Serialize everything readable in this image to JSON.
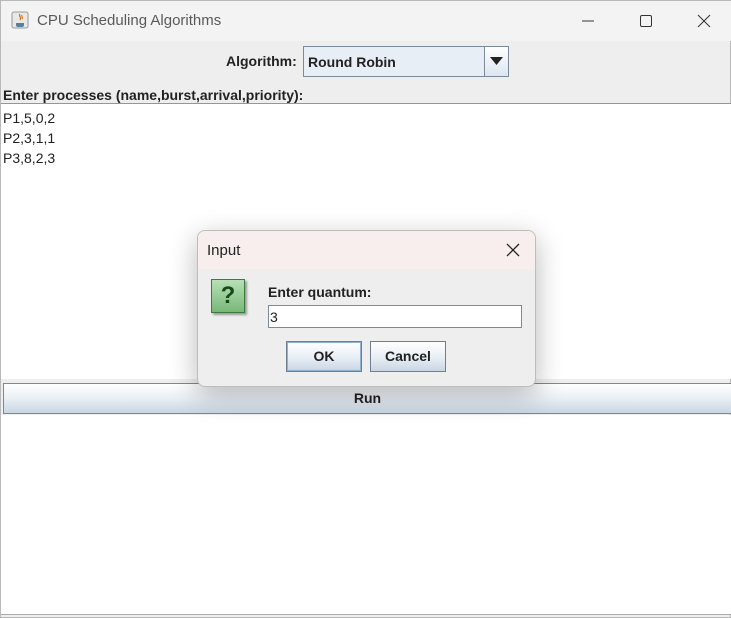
{
  "window": {
    "title": "CPU Scheduling Algorithms"
  },
  "algorithm": {
    "label": "Algorithm:",
    "selected": "Round Robin"
  },
  "processes": {
    "label": "Enter processes (name,burst,arrival,priority):",
    "lines": [
      "P1,5,0,2",
      "P2,3,1,1",
      "P3,8,2,3"
    ]
  },
  "run_button": "Run",
  "dialog": {
    "title": "Input",
    "prompt": "Enter quantum:",
    "value": "3",
    "ok": "OK",
    "cancel": "Cancel",
    "icon": "question-icon"
  },
  "colors": {
    "question_icon_green": "#78b878",
    "button_gradient_bottom": "#c8d5e2"
  }
}
